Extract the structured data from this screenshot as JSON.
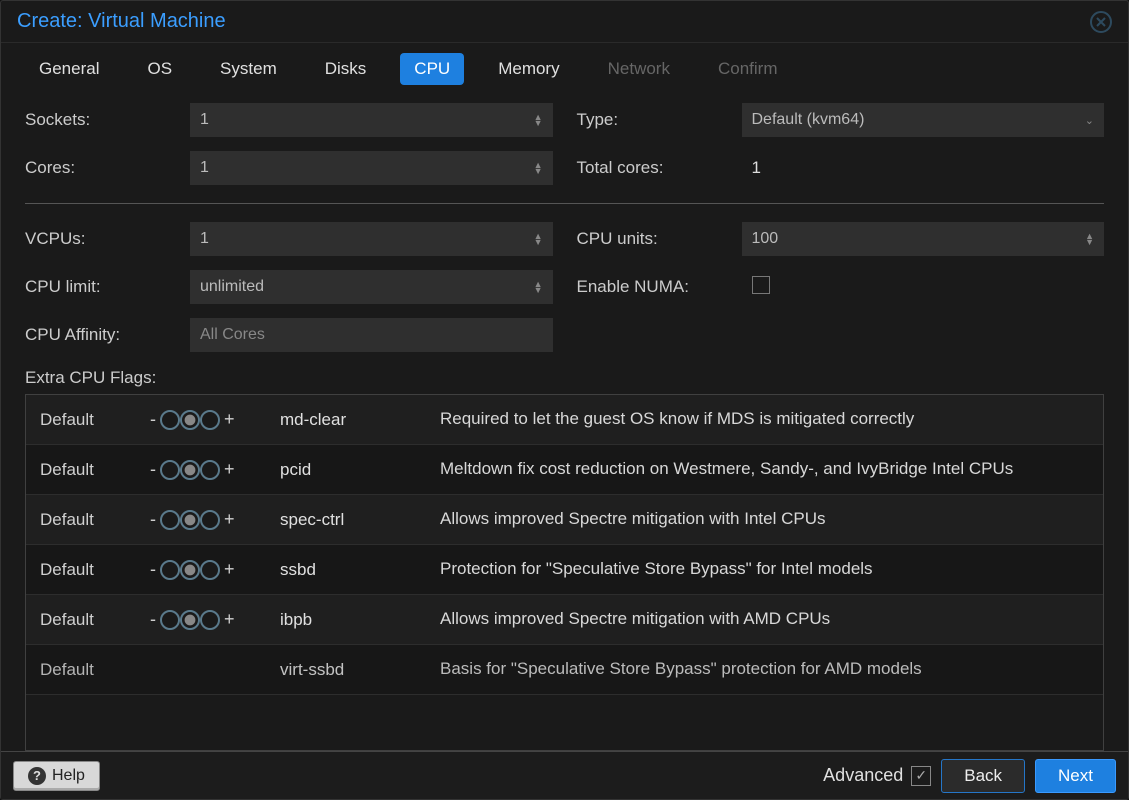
{
  "window": {
    "title": "Create: Virtual Machine"
  },
  "tabs": [
    {
      "label": "General",
      "state": "enabled"
    },
    {
      "label": "OS",
      "state": "enabled"
    },
    {
      "label": "System",
      "state": "enabled"
    },
    {
      "label": "Disks",
      "state": "enabled"
    },
    {
      "label": "CPU",
      "state": "active"
    },
    {
      "label": "Memory",
      "state": "enabled"
    },
    {
      "label": "Network",
      "state": "disabled"
    },
    {
      "label": "Confirm",
      "state": "disabled"
    }
  ],
  "form": {
    "sockets": {
      "label": "Sockets:",
      "value": "1"
    },
    "cores": {
      "label": "Cores:",
      "value": "1"
    },
    "type": {
      "label": "Type:",
      "value": "Default (kvm64)"
    },
    "total_cores": {
      "label": "Total cores:",
      "value": "1"
    },
    "vcpus": {
      "label": "VCPUs:",
      "value": "1"
    },
    "cpu_limit": {
      "label": "CPU limit:",
      "value": "unlimited"
    },
    "cpu_affinity": {
      "label": "CPU Affinity:",
      "placeholder": "All Cores"
    },
    "cpu_units": {
      "label": "CPU units:",
      "value": "100"
    },
    "enable_numa": {
      "label": "Enable NUMA:",
      "checked": false
    }
  },
  "flags": {
    "title": "Extra CPU Flags:",
    "rows": [
      {
        "state": "Default",
        "name": "md-clear",
        "desc": "Required to let the guest OS know if MDS is mitigated correctly"
      },
      {
        "state": "Default",
        "name": "pcid",
        "desc": "Meltdown fix cost reduction on Westmere, Sandy-, and IvyBridge Intel CPUs"
      },
      {
        "state": "Default",
        "name": "spec-ctrl",
        "desc": "Allows improved Spectre mitigation with Intel CPUs"
      },
      {
        "state": "Default",
        "name": "ssbd",
        "desc": "Protection for \"Speculative Store Bypass\" for Intel models"
      },
      {
        "state": "Default",
        "name": "ibpb",
        "desc": "Allows improved Spectre mitigation with AMD CPUs"
      },
      {
        "state": "Default",
        "name": "virt-ssbd",
        "desc": "Basis for \"Speculative Store Bypass\" protection for AMD models"
      }
    ]
  },
  "footer": {
    "help": "Help",
    "advanced": "Advanced",
    "advanced_checked": true,
    "back": "Back",
    "next": "Next"
  }
}
